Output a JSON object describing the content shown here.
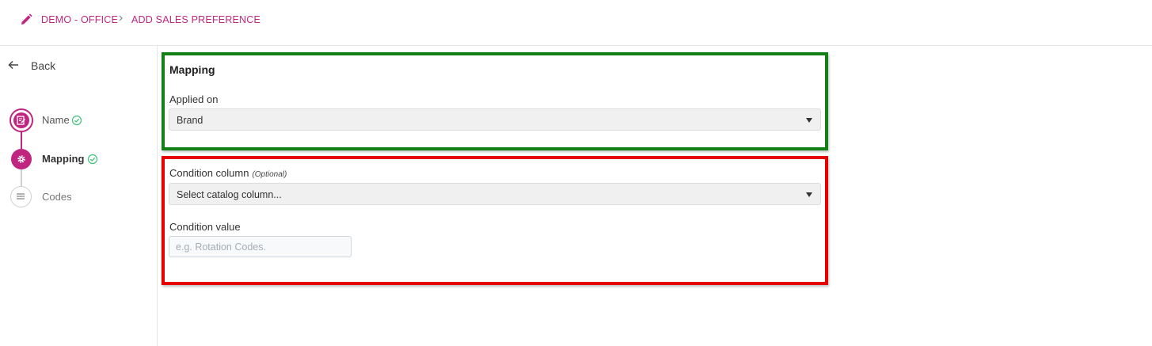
{
  "header": {
    "breadcrumb": [
      "DEMO - OFFICE",
      "ADD SALES PREFERENCE"
    ],
    "edit_icon": "pencil-icon",
    "separator_icon": "chevron-right-icon",
    "accent_color": "#c0267f"
  },
  "sidebar": {
    "back_label": "Back",
    "back_icon": "arrow-left-icon",
    "steps": [
      {
        "label": "Name",
        "icon": "edit-document-icon",
        "status": "complete",
        "active": false
      },
      {
        "label": "Mapping",
        "icon": "gear-icon",
        "status": "complete",
        "active": true
      },
      {
        "label": "Codes",
        "icon": "menu-lines-icon",
        "status": "pending",
        "active": false
      }
    ]
  },
  "main": {
    "section_title": "Mapping",
    "applied_on": {
      "label": "Applied on",
      "value": "Brand"
    },
    "condition_column": {
      "label": "Condition column",
      "optional_tag": "(Optional)",
      "value": "Select catalog column..."
    },
    "condition_value": {
      "label": "Condition value",
      "value": "",
      "placeholder": "e.g. Rotation Codes."
    }
  },
  "highlight_colors": {
    "green": "#137f17",
    "red": "#e60000"
  }
}
